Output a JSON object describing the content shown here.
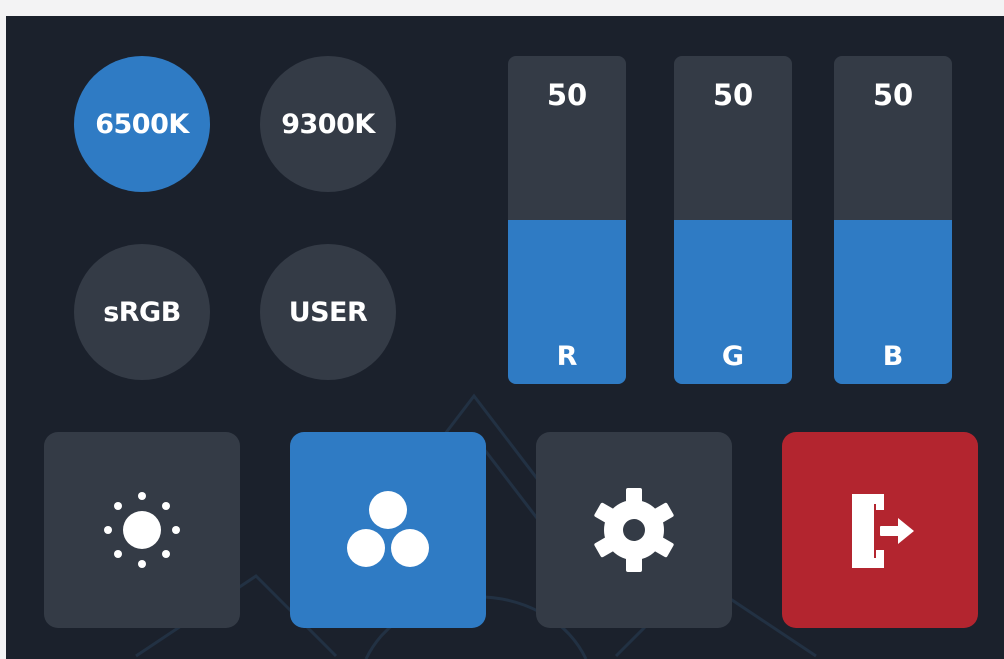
{
  "presets": [
    {
      "label": "6500K",
      "active": true
    },
    {
      "label": "9300K",
      "active": false
    },
    {
      "label": "sRGB",
      "active": false
    },
    {
      "label": "USER",
      "active": false
    }
  ],
  "rgb": [
    {
      "channel": "R",
      "value": 50,
      "level_percent": 50
    },
    {
      "channel": "G",
      "value": 50,
      "level_percent": 50
    },
    {
      "channel": "B",
      "value": 50,
      "level_percent": 50
    }
  ],
  "toolbar": [
    {
      "icon": "brightness-icon",
      "active": false
    },
    {
      "icon": "color-circles-icon",
      "active": true
    },
    {
      "icon": "gear-icon",
      "active": false
    },
    {
      "icon": "exit-door-icon",
      "active": false
    }
  ],
  "colors": {
    "accent": "#2f7bc4",
    "tile": "#343b46",
    "background": "#1b212c",
    "exit": "#b3252f"
  }
}
